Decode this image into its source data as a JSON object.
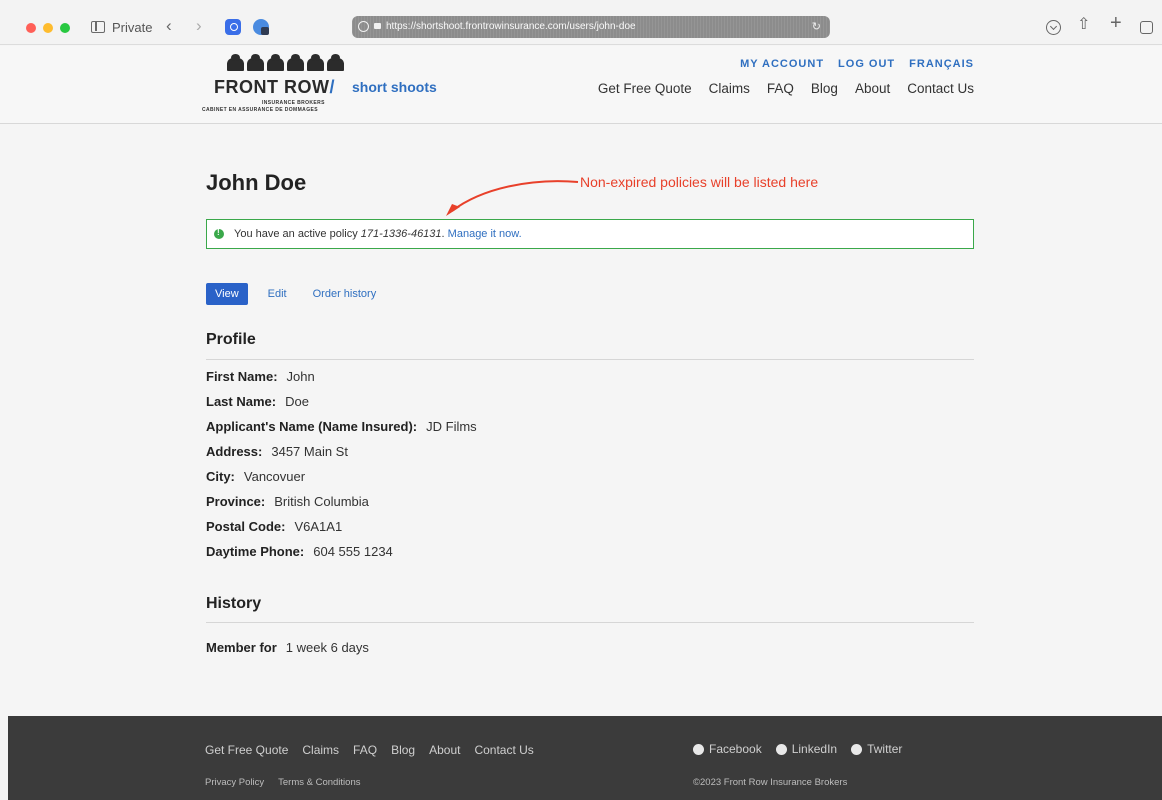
{
  "browser": {
    "mode_label": "Private",
    "url": "https://shortshoot.frontrowinsurance.com/users/john-doe"
  },
  "logo": {
    "main": "FRONT ROW",
    "slash": "/",
    "product": "short shoots",
    "sub1": "INSURANCE BROKERS",
    "sub2": "CABINET EN ASSURANCE DE DOMMAGES"
  },
  "top_links": [
    "MY ACCOUNT",
    "LOG OUT",
    "FRANÇAIS"
  ],
  "main_nav": [
    "Get Free Quote",
    "Claims",
    "FAQ",
    "Blog",
    "About",
    "Contact Us"
  ],
  "page": {
    "title": "John Doe",
    "annotation": "Non-expired policies will be listed here"
  },
  "colors": {
    "accent": "#2f6fc0",
    "annotation": "#e8402a",
    "success": "#3aa84a",
    "footer_bg": "#3b3b3b"
  },
  "alert": {
    "prefix": "You have an active policy ",
    "policy_number": "171-1336-46131",
    "suffix": ". ",
    "link": "Manage it now."
  },
  "tabs": [
    "View",
    "Edit",
    "Order history"
  ],
  "profile": {
    "title": "Profile",
    "fields": [
      {
        "label": "First Name:",
        "value": "John"
      },
      {
        "label": "Last Name:",
        "value": "Doe"
      },
      {
        "label": "Applicant's Name (Name Insured):",
        "value": "JD Films"
      },
      {
        "label": "Address:",
        "value": "3457 Main St"
      },
      {
        "label": "City:",
        "value": "Vancovuer"
      },
      {
        "label": "Province:",
        "value": "British Columbia"
      },
      {
        "label": "Postal Code:",
        "value": "V6A1A1"
      },
      {
        "label": "Daytime Phone:",
        "value": "604 555 1234"
      }
    ]
  },
  "history": {
    "title": "History",
    "member_label": "Member for",
    "member_value": "1 week 6 days"
  },
  "footer": {
    "nav": [
      "Get Free Quote",
      "Claims",
      "FAQ",
      "Blog",
      "About",
      "Contact Us"
    ],
    "legal": [
      "Privacy Policy",
      "Terms & Conditions"
    ],
    "social": [
      "Facebook",
      "LinkedIn",
      "Twitter"
    ],
    "copyright": "©2023 Front Row Insurance Brokers"
  }
}
